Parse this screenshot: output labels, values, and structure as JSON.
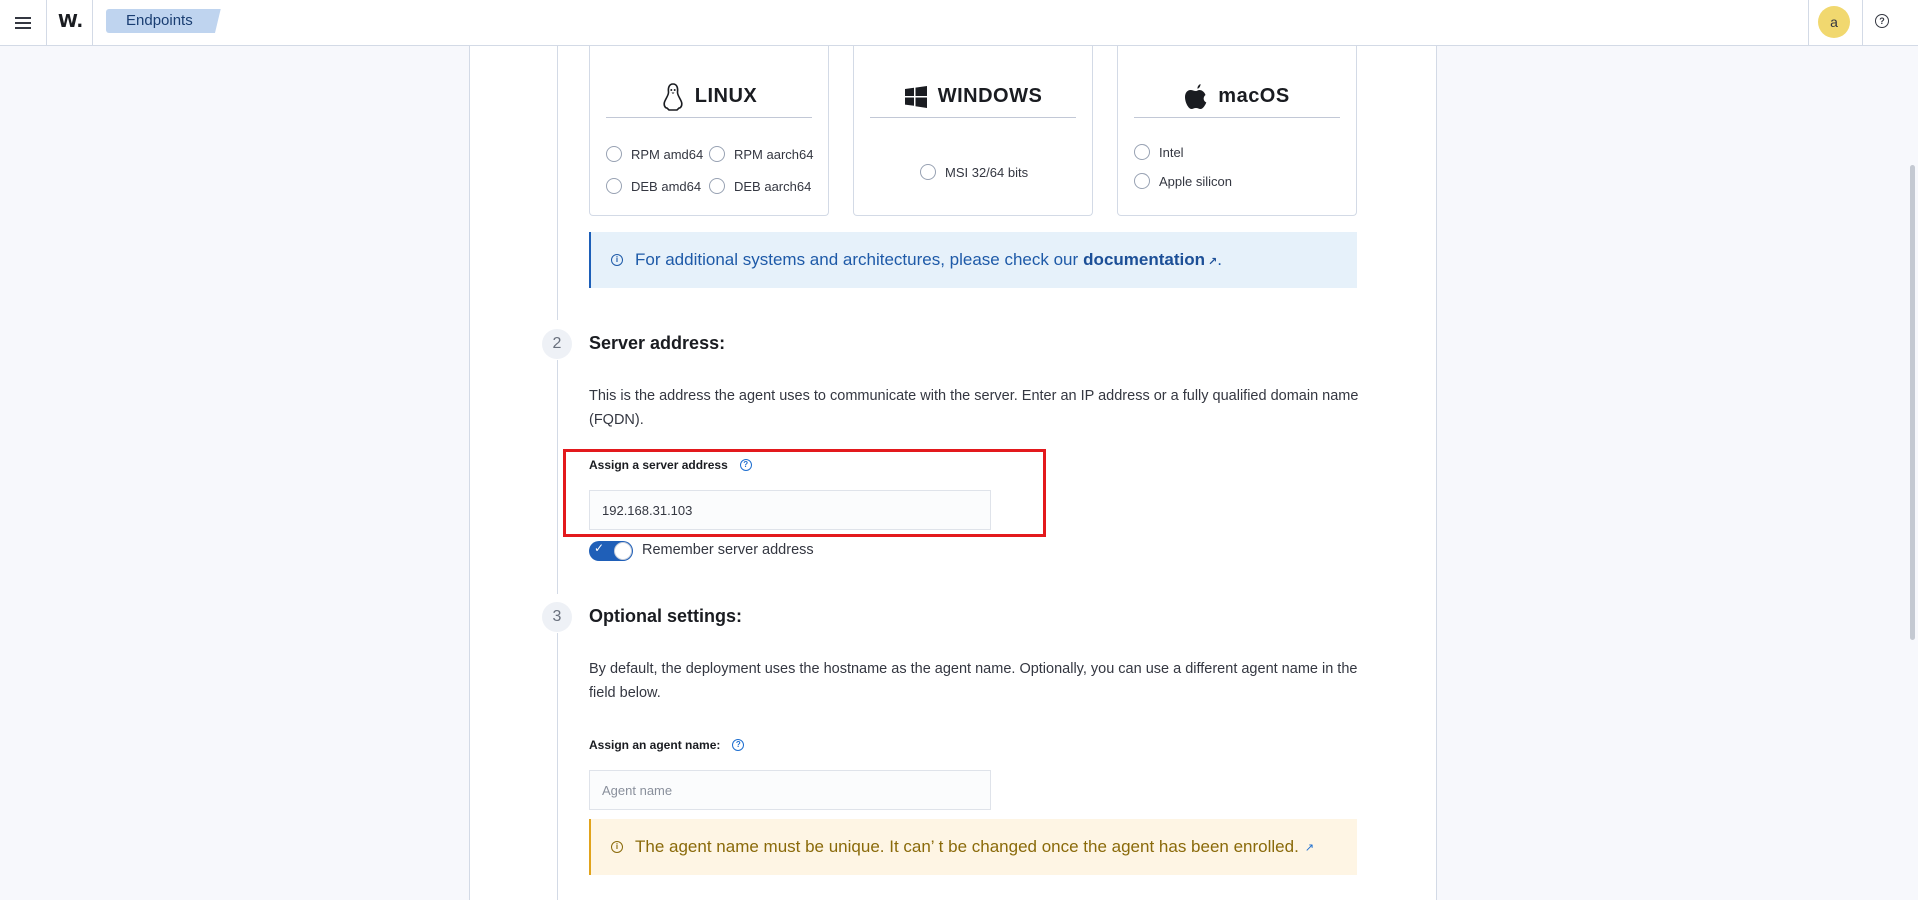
{
  "header": {
    "logo": "W.",
    "breadcrumb": "Endpoints",
    "avatar_letter": "a"
  },
  "os_cards": [
    {
      "title": "LINUX",
      "icon": "linux-penguin-icon",
      "options": [
        "RPM amd64",
        "RPM aarch64",
        "DEB amd64",
        "DEB aarch64"
      ]
    },
    {
      "title": "WINDOWS",
      "icon": "windows-icon",
      "options": [
        "MSI 32/64 bits"
      ]
    },
    {
      "title": "macOS",
      "icon": "apple-icon",
      "options": [
        "Intel",
        "Apple silicon"
      ]
    }
  ],
  "info_callout": {
    "text": "For additional systems and architectures, please check our",
    "link": "documentation",
    "suffix": "."
  },
  "step2": {
    "number": "2",
    "title": "Server address:",
    "description": "This is the address the agent uses to communicate with the server. Enter an IP address or a fully qualified domain name (FQDN).",
    "field_label": "Assign a server address",
    "field_value": "192.168.31.103",
    "toggle_label": "Remember server address",
    "toggle_on": true
  },
  "step3": {
    "number": "3",
    "title": "Optional settings:",
    "description": "By default, the deployment uses the hostname as the agent name. Optionally, you can use a different agent name in the field below.",
    "field_label": "Assign an agent name:",
    "field_placeholder": "Agent name"
  },
  "warn_callout": {
    "text": "The agent name must be unique. It can’ t be changed once the agent has been enrolled."
  },
  "colors": {
    "accent": "#1f5fb8",
    "highlight_border": "#e3191d",
    "info_bg": "#e6f1fa",
    "warn_bg": "#fef5e4"
  }
}
